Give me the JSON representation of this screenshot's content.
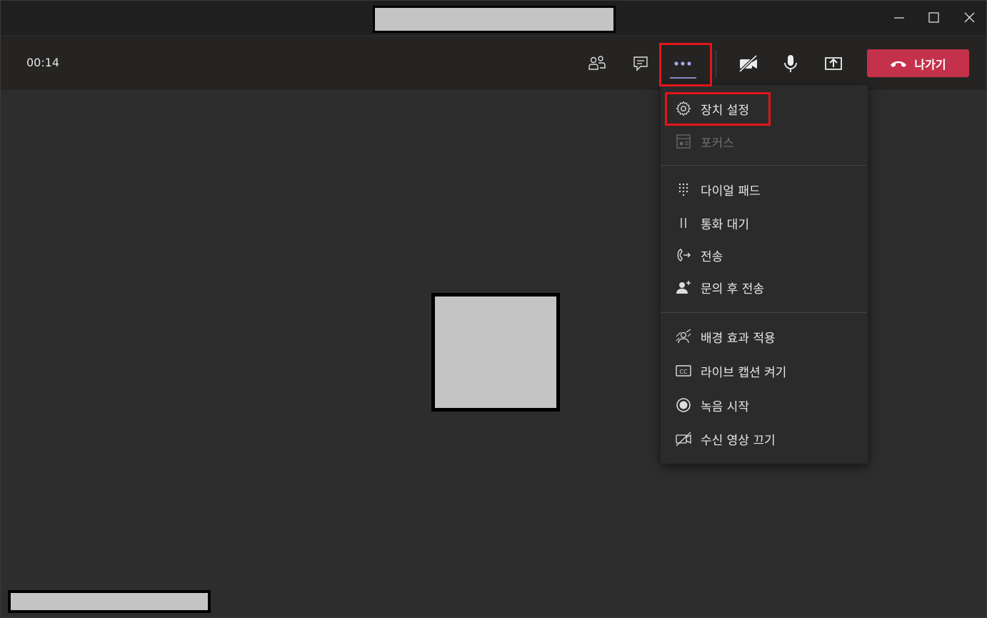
{
  "window": {
    "controls": [
      "minimize",
      "maximize",
      "close"
    ]
  },
  "toolbar": {
    "timer": "00:14",
    "leave_label": "나가기",
    "icons": [
      "participants-icon",
      "chat-icon",
      "more-actions-icon",
      "camera-off-icon",
      "microphone-icon",
      "share-screen-icon"
    ]
  },
  "menu": {
    "items": [
      {
        "label": "장치 설정",
        "icon": "gear-icon",
        "enabled": true
      },
      {
        "label": "포커스",
        "icon": "focus-icon",
        "enabled": false
      },
      {
        "label": "다이얼 패드",
        "icon": "dialpad-icon",
        "enabled": true
      },
      {
        "label": "통화 대기",
        "icon": "pause-icon",
        "enabled": true
      },
      {
        "label": "전송",
        "icon": "transfer-icon",
        "enabled": true
      },
      {
        "label": "문의 후 전송",
        "icon": "consult-transfer-icon",
        "enabled": true
      },
      {
        "label": "배경 효과 적용",
        "icon": "background-effects-icon",
        "enabled": true
      },
      {
        "label": "라이브 캡션 켜기",
        "icon": "cc-icon",
        "enabled": true
      },
      {
        "label": "녹음 시작",
        "icon": "record-icon",
        "enabled": true
      },
      {
        "label": "수신 영상 끄기",
        "icon": "video-off-icon",
        "enabled": true
      }
    ]
  },
  "colors": {
    "leave": "#c4314b",
    "highlight": "#e3151a",
    "accent": "#8b8cc7"
  }
}
